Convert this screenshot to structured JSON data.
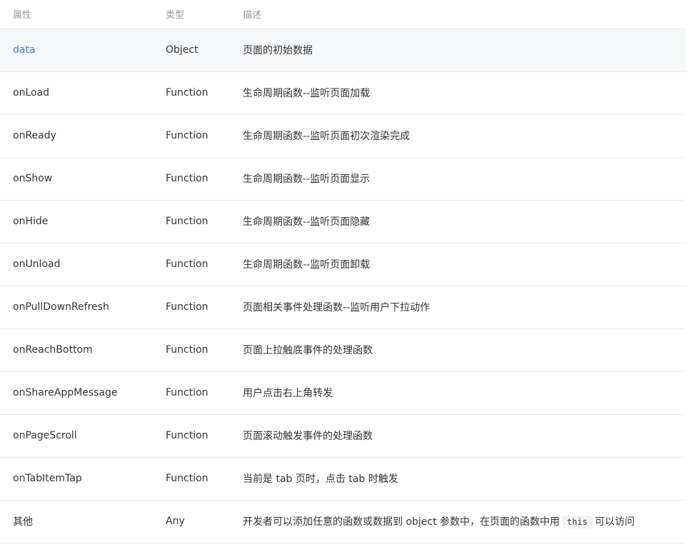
{
  "headers": {
    "name": "属性",
    "type": "类型",
    "desc": "描述"
  },
  "rows": [
    {
      "name": "data",
      "type": "Object",
      "desc": "页面的初始数据",
      "link": true
    },
    {
      "name": "onLoad",
      "type": "Function",
      "desc": "生命周期函数--监听页面加载"
    },
    {
      "name": "onReady",
      "type": "Function",
      "desc": "生命周期函数--监听页面初次渲染完成"
    },
    {
      "name": "onShow",
      "type": "Function",
      "desc": "生命周期函数--监听页面显示"
    },
    {
      "name": "onHide",
      "type": "Function",
      "desc": "生命周期函数--监听页面隐藏"
    },
    {
      "name": "onUnload",
      "type": "Function",
      "desc": "生命周期函数--监听页面卸载"
    },
    {
      "name": "onPullDownRefresh",
      "type": "Function",
      "desc": "页面相关事件处理函数--监听用户下拉动作"
    },
    {
      "name": "onReachBottom",
      "type": "Function",
      "desc": "页面上拉触底事件的处理函数"
    },
    {
      "name": "onShareAppMessage",
      "type": "Function",
      "desc": "用户点击右上角转发"
    },
    {
      "name": "onPageScroll",
      "type": "Function",
      "desc": "页面滚动触发事件的处理函数"
    },
    {
      "name": "onTabItemTap",
      "type": "Function",
      "desc": "当前是 tab 页时，点击 tab 时触发"
    },
    {
      "name": "其他",
      "type": "Any",
      "desc_before": "开发者可以添加任意的函数或数据到 object 参数中，在页面的函数中用",
      "desc_code": "this",
      "desc_after": "可以访问"
    }
  ],
  "colors": {
    "link": "#3d7cc9",
    "header_text": "#9a9a9a",
    "body_text": "#333333",
    "stripe": "#f7f8fa",
    "border": "#ececec"
  }
}
